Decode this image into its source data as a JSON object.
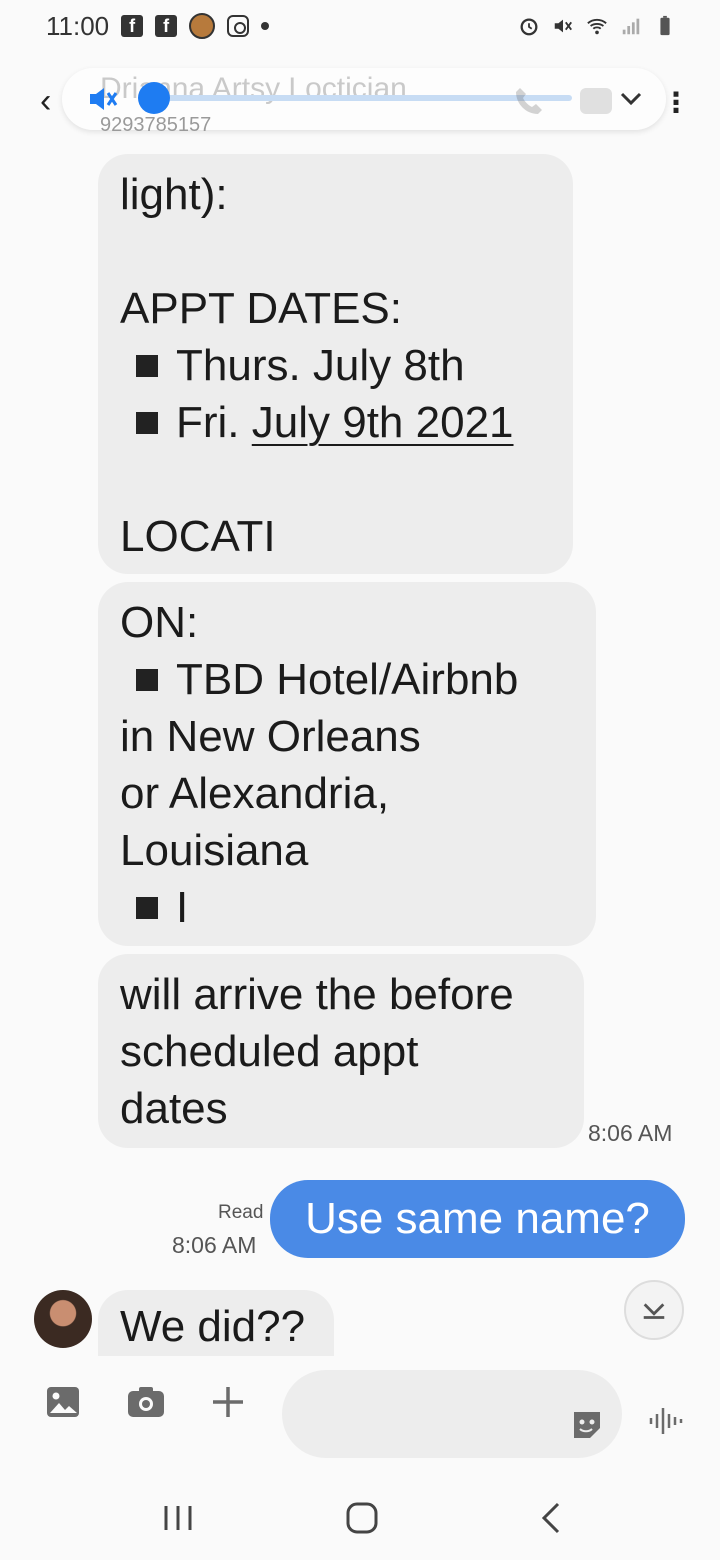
{
  "status_bar": {
    "time": "11:00"
  },
  "header": {
    "contact_name": "Drianna Artsy Loctician",
    "contact_number": "9293785157"
  },
  "messages": {
    "bubble1": {
      "lines": [
        "light):",
        "",
        "APPT DATES:"
      ],
      "bullets": [
        "Thurs. July 8th",
        "Fri. "
      ],
      "underlined": "July 9th 2021",
      "tail": [
        "",
        "LOCATI"
      ]
    },
    "bubble2": {
      "line1": "ON:",
      "bullet1": "TBD Hotel/Airbnb",
      "lines": [
        "in New Orleans",
        "or Alexandria,",
        "Louisiana"
      ],
      "bullet2": "I"
    },
    "bubble3": {
      "lines": [
        "will arrive the before",
        "scheduled appt",
        "dates"
      ]
    },
    "time1": "8:06 AM",
    "outgoing": {
      "read_label": "Read",
      "time": "8:06 AM",
      "text": "Use same name?"
    },
    "incoming_last": {
      "text": "We did??"
    }
  },
  "composer": {
    "placeholder": ""
  },
  "colors": {
    "accent": "#1e7cf2",
    "outgoing_bubble": "#4a8ae6",
    "incoming_bubble": "#ededed"
  }
}
